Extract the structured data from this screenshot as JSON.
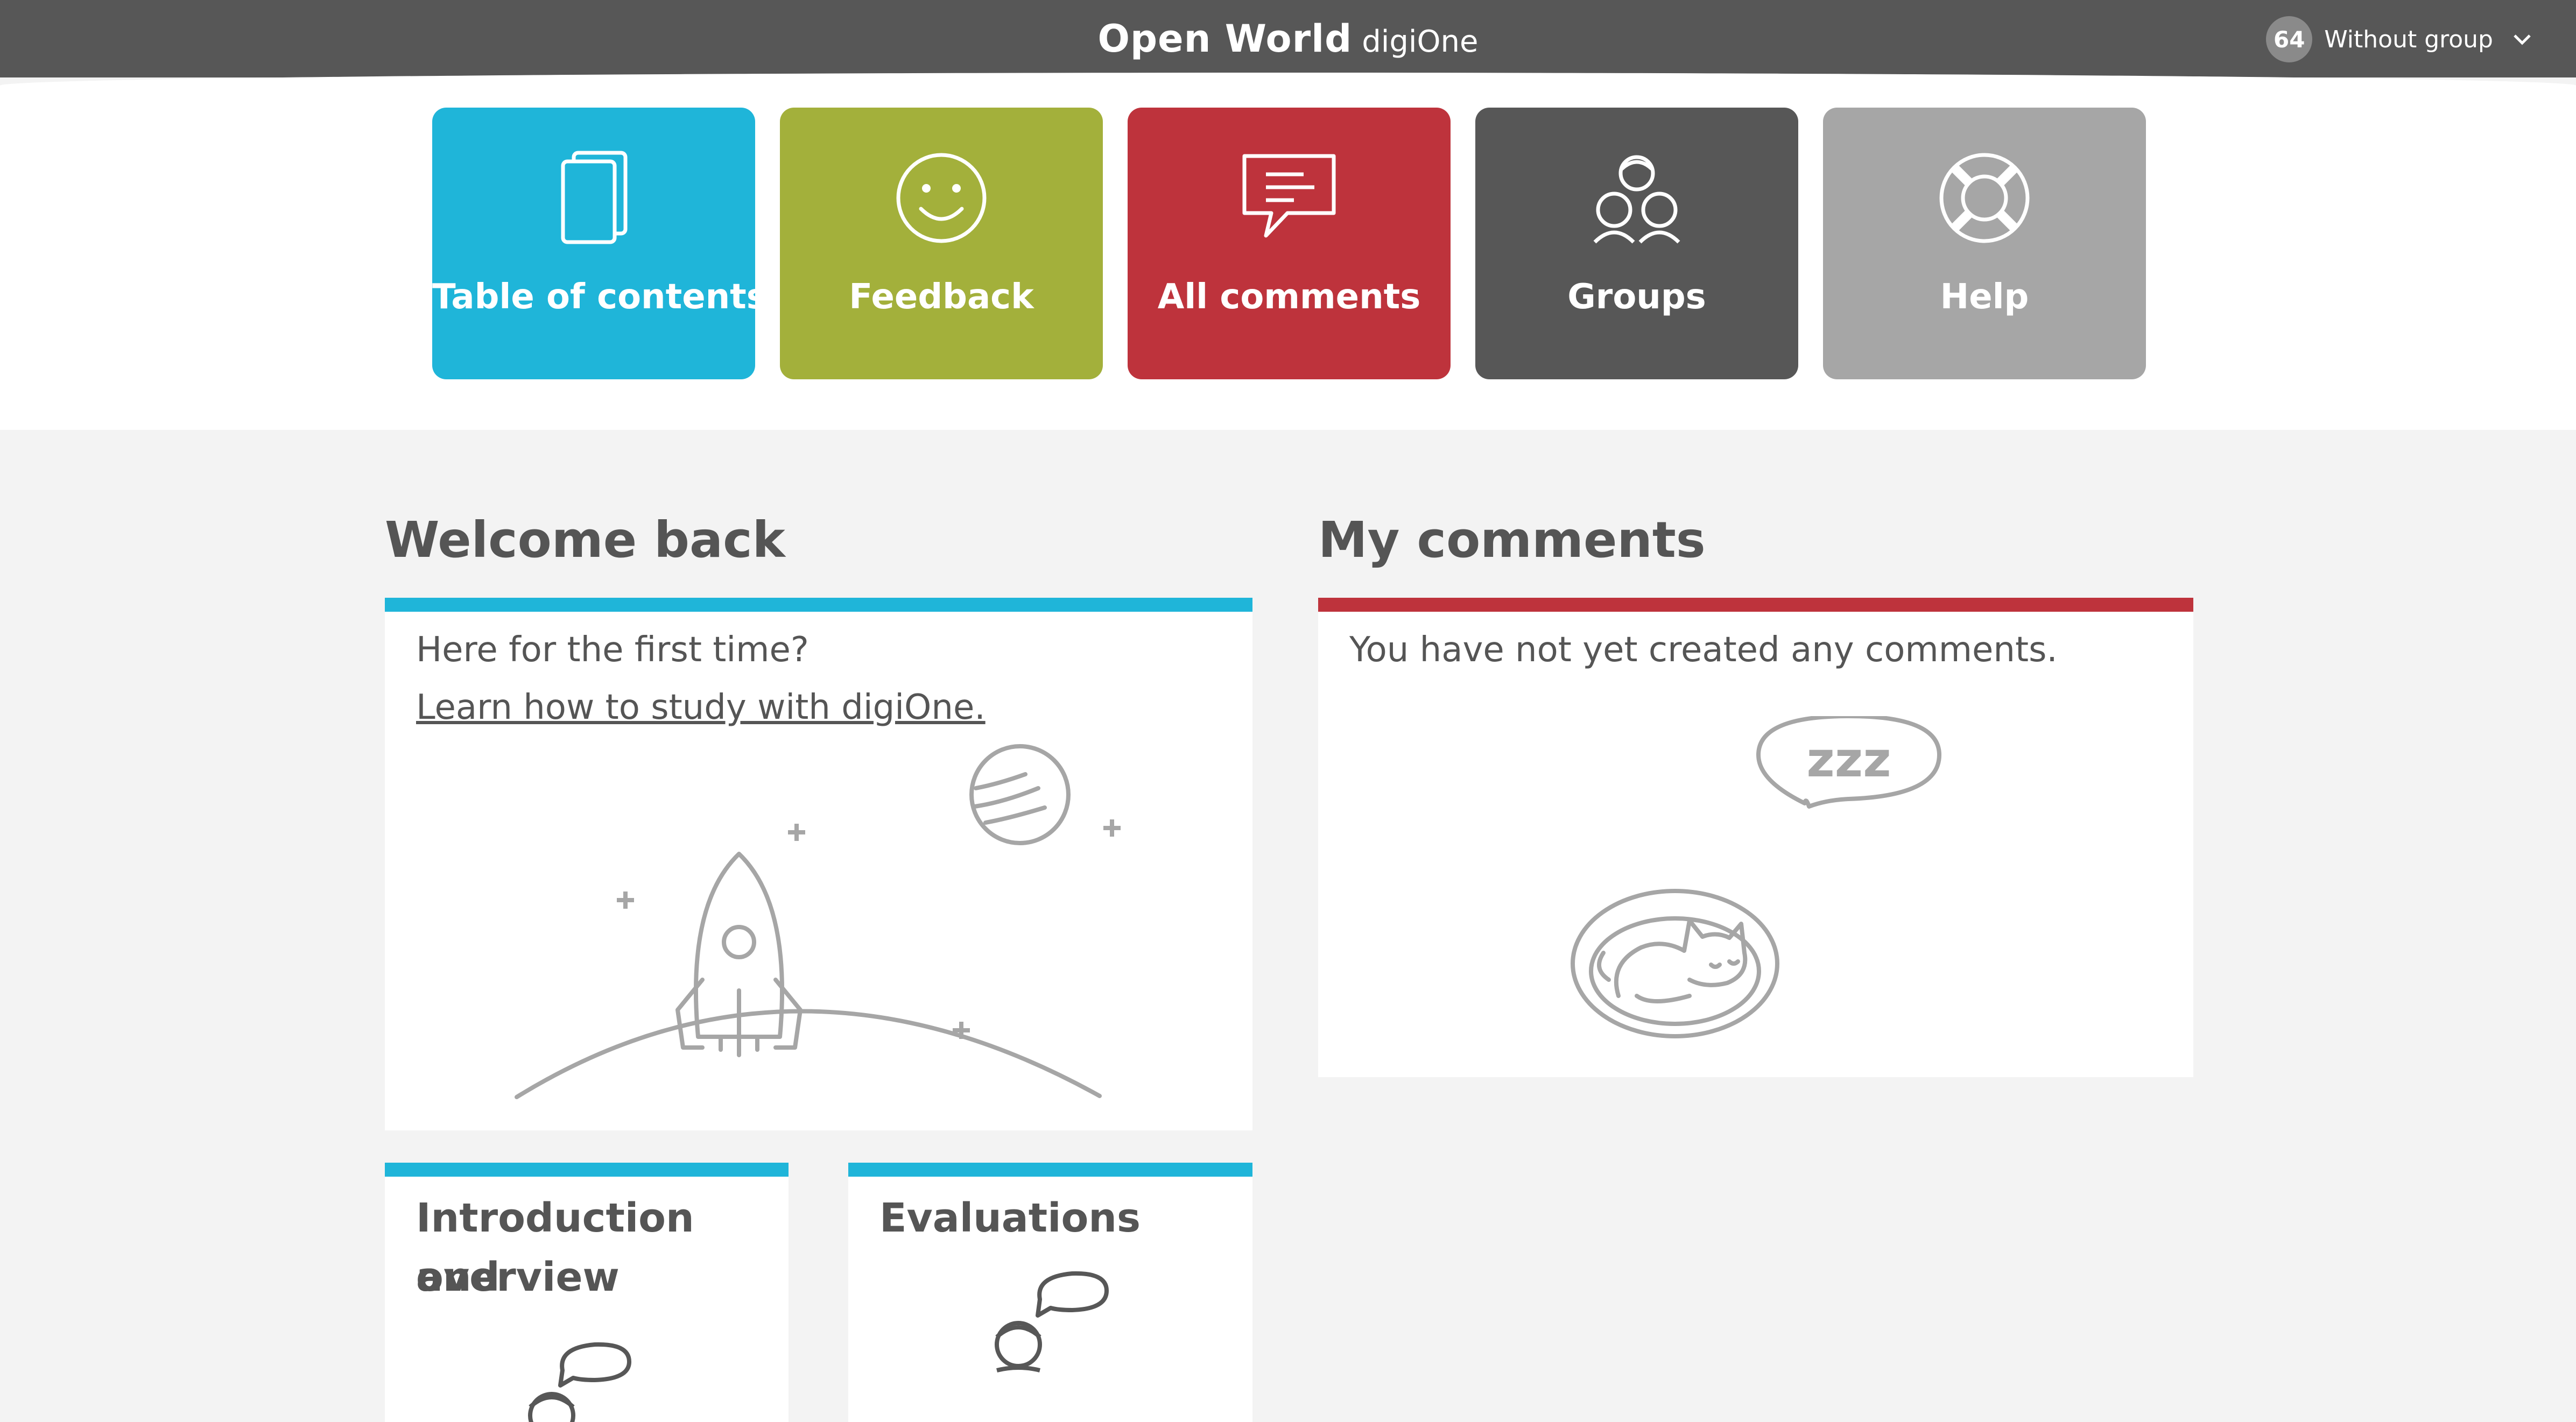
{
  "header": {
    "brand_name": "Open World",
    "brand_sub": "digiOne",
    "user_badge": "64",
    "group_label": "Without group"
  },
  "menu": {
    "tiles": [
      {
        "label": "Table of contents",
        "color": "#1fb5d9",
        "icon": "book-icon"
      },
      {
        "label": "Feedback",
        "color": "#a3b03b",
        "icon": "smiley-icon"
      },
      {
        "label": "All comments",
        "color": "#be333c",
        "icon": "speech-bubble-icon"
      },
      {
        "label": "Groups",
        "color": "#575757",
        "icon": "group-icon"
      },
      {
        "label": "Help",
        "color": "#a6a6a6",
        "icon": "lifebuoy-icon"
      }
    ]
  },
  "welcome": {
    "title": "Welcome back",
    "accent": "#1fb5d9",
    "line1": "Here for the first time?",
    "link": "Learn how to study with digiOne."
  },
  "my_comments": {
    "title": "My comments",
    "accent": "#be333c",
    "empty_text": "You have not yet created any comments.",
    "sleep_text": "zzz"
  },
  "modules": [
    {
      "title_line1": "Introduction and",
      "title_line2": "overview"
    },
    {
      "title_line1": "Evaluations"
    }
  ]
}
